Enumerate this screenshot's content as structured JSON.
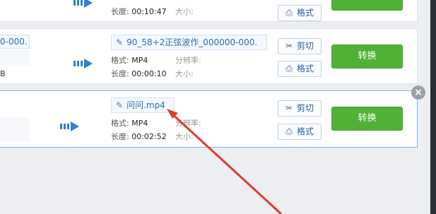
{
  "rows": [
    {
      "src_name": "",
      "src_size": "",
      "dst_name": "",
      "format_label": "",
      "format_value": "",
      "resolution_label": "",
      "duration_label": "长度:",
      "duration_value": "00:10:47",
      "size_label": "大小:",
      "cut_label": "",
      "format_btn_label": "格式",
      "convert_label": ""
    },
    {
      "src_name": "0-000.",
      "src_size": "B",
      "dst_name": "90_58+2正弦波作_000000-000.",
      "format_label": "格式:",
      "format_value": "MP4",
      "resolution_label": "分辨率:",
      "duration_label": "长度:",
      "duration_value": "00:00:10",
      "size_label": "大小:",
      "cut_label": "剪切",
      "format_btn_label": "格式",
      "convert_label": "转换"
    },
    {
      "src_name": "",
      "src_size": "",
      "dst_name": "问问.mp4",
      "format_label": "格式:",
      "format_value": "MP4",
      "resolution_label": "分辨率:",
      "duration_label": "长度:",
      "duration_value": "00:02:52",
      "size_label": "大小:",
      "cut_label": "剪切",
      "format_btn_label": "格式",
      "convert_label": "转换"
    }
  ],
  "icons": {
    "pencil": "✎",
    "scissors": "✂",
    "format": "⎙",
    "close": "×"
  },
  "colors": {
    "convert_green": "#4fb236",
    "link_blue": "#2b6cb0",
    "arrow_blue": "#2f7fd6",
    "annotation_red": "#e03b2f"
  }
}
